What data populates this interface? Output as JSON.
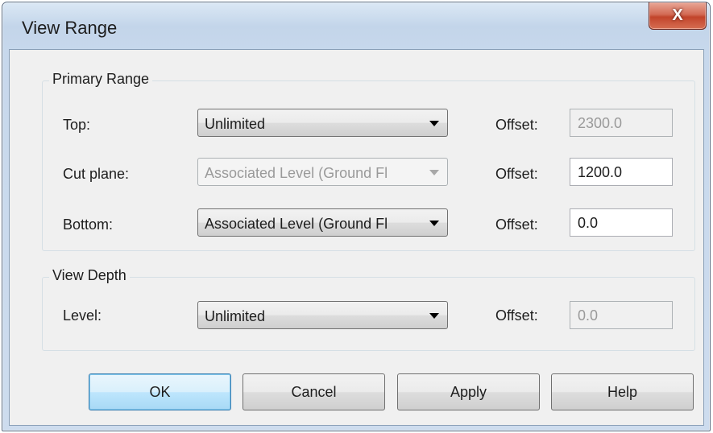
{
  "window": {
    "title": "View Range",
    "close_label": "X"
  },
  "primary_range": {
    "group_label": "Primary Range",
    "rows": [
      {
        "label": "Top:",
        "combo_value": "Unlimited",
        "combo_enabled": true,
        "offset_label": "Offset:",
        "offset_value": "2300.0",
        "offset_enabled": false
      },
      {
        "label": "Cut plane:",
        "combo_value": "Associated Level (Ground Fl",
        "combo_enabled": false,
        "offset_label": "Offset:",
        "offset_value": "1200.0",
        "offset_enabled": true
      },
      {
        "label": "Bottom:",
        "combo_value": "Associated Level (Ground Fl",
        "combo_enabled": true,
        "offset_label": "Offset:",
        "offset_value": "0.0",
        "offset_enabled": true
      }
    ]
  },
  "view_depth": {
    "group_label": "View Depth",
    "label": "Level:",
    "combo_value": "Unlimited",
    "combo_enabled": true,
    "offset_label": "Offset:",
    "offset_value": "0.0",
    "offset_enabled": false
  },
  "buttons": {
    "ok": "OK",
    "cancel": "Cancel",
    "apply": "Apply",
    "help": "Help"
  },
  "icons": {
    "dropdown": "chevron-down-icon",
    "close": "close-icon"
  }
}
